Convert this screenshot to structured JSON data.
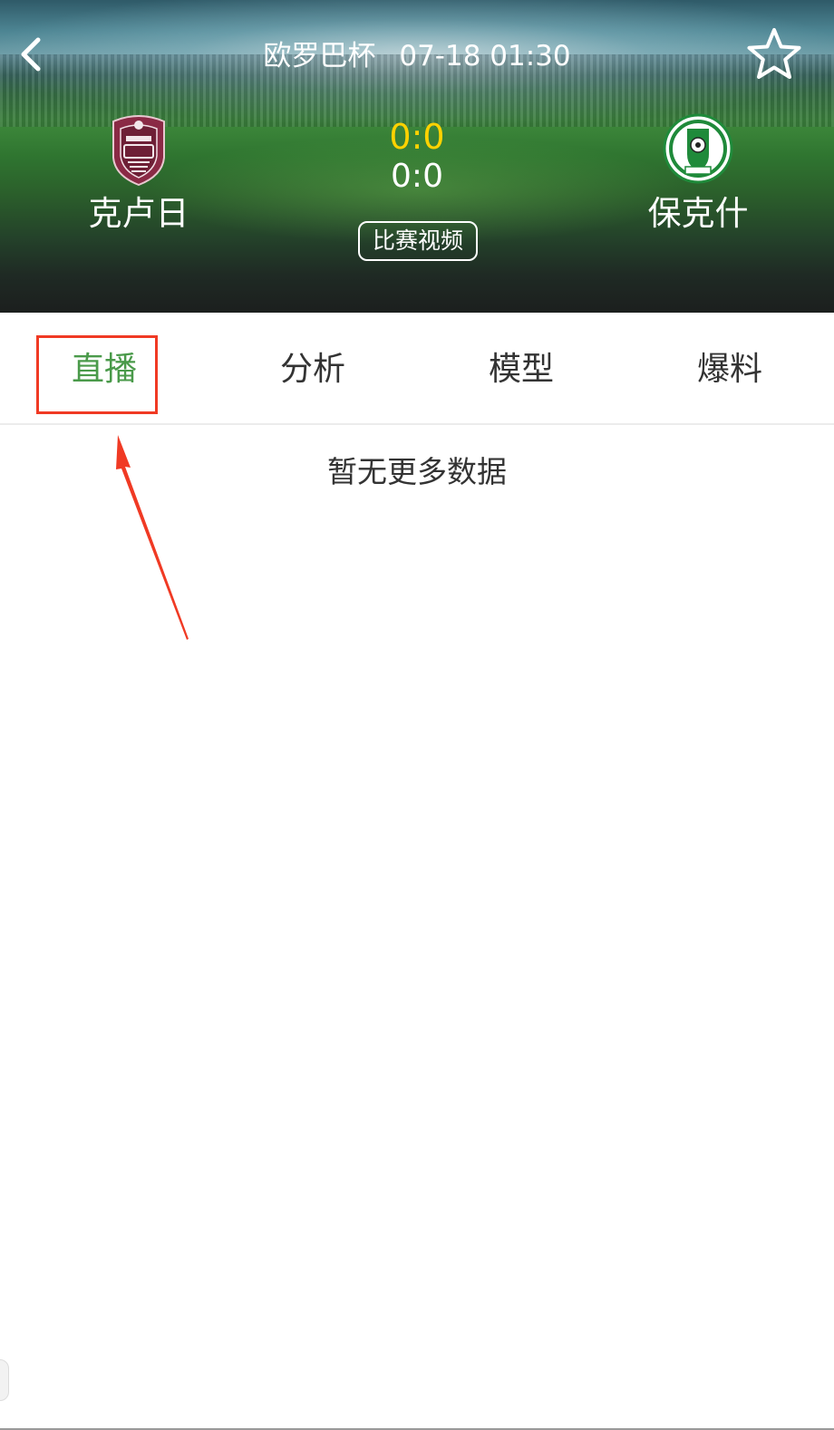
{
  "header": {
    "competition": "欧罗巴杯",
    "datetime": "07-18 01:30",
    "home_team": {
      "name": "克卢日",
      "logo": "cfr-cluj-crest-icon",
      "color": "#8a2a45"
    },
    "away_team": {
      "name": "保克什",
      "logo": "paksi-fc-crest-icon",
      "color": "#1f8a3a"
    },
    "score_main": "0:0",
    "score_sub": "0:0",
    "video_button": "比赛视频",
    "icons": {
      "back": "chevron-left-icon",
      "favorite": "star-outline-icon"
    }
  },
  "tabs": [
    {
      "label": "直播",
      "active": true
    },
    {
      "label": "分析",
      "active": false
    },
    {
      "label": "模型",
      "active": false
    },
    {
      "label": "爆料",
      "active": false
    }
  ],
  "content": {
    "empty_message": "暂无更多数据"
  },
  "colors": {
    "accent_green": "#4a9a4a",
    "score_yellow": "#ffd200",
    "annotation_red": "#f03a24"
  }
}
